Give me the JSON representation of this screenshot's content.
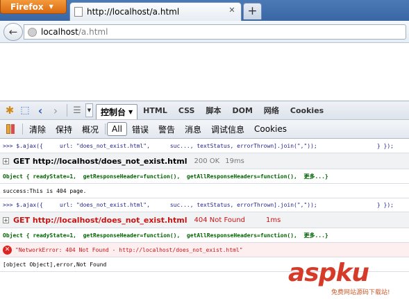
{
  "browser": {
    "app_button": "Firefox",
    "tab_title": "http://localhost/a.html",
    "url_host": "localhost",
    "url_path": "/a.html"
  },
  "firebug": {
    "panel_menu": "控制台",
    "tabs": [
      "HTML",
      "CSS",
      "脚本",
      "DOM",
      "网络",
      "Cookies"
    ],
    "filters": {
      "clear": "清除",
      "persist": "保持",
      "profile": "概况",
      "all": "All",
      "errors": "错误",
      "warnings": "警告",
      "info": "消息",
      "debug": "调试信息",
      "cookies": "Cookies"
    }
  },
  "log": {
    "cmd1": ">>> $.ajax({     url: \"does_not_exist.html\",      suc..., textStatus, errorThrown].join(\",\"));",
    "cmd1_end": "} });",
    "req1_method": "GET http://localhost/does_not_exist.html",
    "req1_status": "200 OK",
    "req1_time": "19ms",
    "obj1": "Object { readyState=1,  getResponseHeader=function(),  getAllResponseHeaders=function(),  更多...}",
    "success": "success:This is 404 page.",
    "cmd2": ">>> $.ajax({     url: \"does_not_exist.html\",      suc..., textStatus, errorThrown].join(\",\"));",
    "cmd2_end": "} });",
    "req2_method": "GET http://localhost/does_not_exist.html",
    "req2_status": "404 Not Found",
    "req2_time": "1ms",
    "obj2": "Object { readyState=1,  getResponseHeader=function(),  getAllResponseHeaders=function(),  更多...}",
    "error_msg": "\"NetworkError: 404 Not Found - http://localhost/does_not_exist.html\"",
    "result": "[object Object],error,Not Found"
  },
  "watermark": {
    "brand": "aspku",
    "sub": "免费网站源码下载站!",
    "color": "#d63b2a"
  }
}
